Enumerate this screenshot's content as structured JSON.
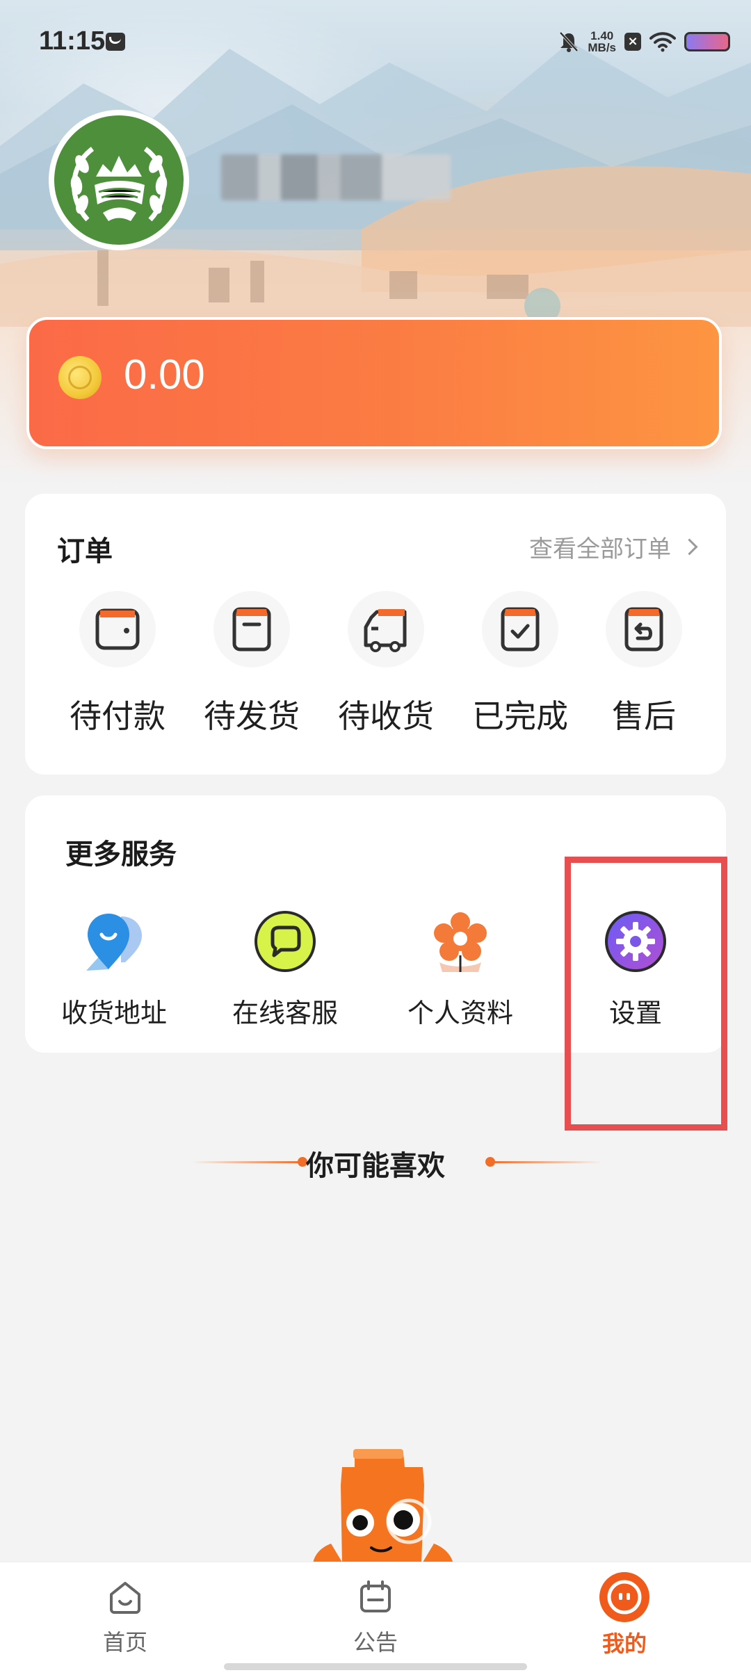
{
  "status_bar": {
    "time": "11:15",
    "net_speed_value": "1.40",
    "net_speed_unit": "MB/s",
    "icons": [
      "mail-icon",
      "bell-off-icon",
      "close-box-icon",
      "wifi-icon",
      "battery-icon"
    ]
  },
  "profile": {
    "avatar_icon": "green-farm-emblem-icon",
    "username": ""
  },
  "balance": {
    "coin_icon": "coin-icon",
    "amount": "0.00"
  },
  "orders": {
    "title": "订单",
    "view_all": "查看全部订单",
    "items": [
      {
        "label": "待付款",
        "icon": "wallet-icon"
      },
      {
        "label": "待发货",
        "icon": "box-icon"
      },
      {
        "label": "待收货",
        "icon": "truck-icon"
      },
      {
        "label": "已完成",
        "icon": "check-box-icon"
      },
      {
        "label": "售后",
        "icon": "return-icon"
      }
    ]
  },
  "services": {
    "title": "更多服务",
    "items": [
      {
        "label": "收货地址",
        "icon": "location-pin-icon"
      },
      {
        "label": "在线客服",
        "icon": "chat-bubble-icon"
      },
      {
        "label": "个人资料",
        "icon": "flower-icon"
      },
      {
        "label": "设置",
        "icon": "gear-icon"
      }
    ]
  },
  "recommend": {
    "title": "你可能喜欢"
  },
  "tabbar": {
    "items": [
      {
        "label": "首页",
        "icon": "home-icon",
        "active": false
      },
      {
        "label": "公告",
        "icon": "calendar-icon",
        "active": false
      },
      {
        "label": "我的",
        "icon": "face-icon",
        "active": true
      }
    ]
  },
  "colors": {
    "accent": "#f05a1a",
    "balance_gradient_start": "#fb6a47",
    "balance_gradient_end": "#fd9542",
    "highlight": "#e84d4f"
  }
}
